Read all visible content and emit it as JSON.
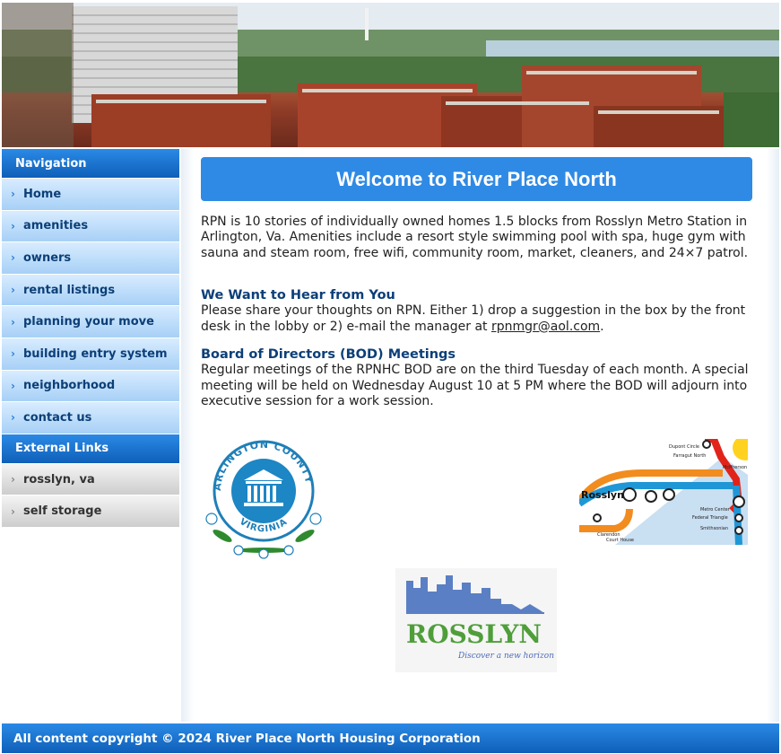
{
  "banner": {
    "alt": "River Place North aerial view"
  },
  "sidebar": {
    "nav_heading": "Navigation",
    "nav_items": [
      {
        "label": "Home"
      },
      {
        "label": "amenities"
      },
      {
        "label": "owners"
      },
      {
        "label": "rental listings"
      },
      {
        "label": "planning your move"
      },
      {
        "label": "building entry system"
      },
      {
        "label": "neighborhood"
      },
      {
        "label": "contact us"
      }
    ],
    "ext_heading": "External Links",
    "ext_items": [
      {
        "label": "rosslyn, va"
      },
      {
        "label": "self storage"
      }
    ]
  },
  "main": {
    "title": "Welcome to River Place North",
    "intro": "RPN is 10 stories of individually owned homes 1.5 blocks from Rosslyn Metro Station in Arlington, Va. Amenities include a resort style swimming pool with spa, huge gym with sauna and steam room, free wifi, community room, market, cleaners, and 24×7 patrol.",
    "feedback_heading": "We Want to Hear from You",
    "feedback_text": "Please share your thoughts on RPN. Either 1) drop a suggestion in the box by the front desk in the lobby or 2) e-mail the manager at ",
    "feedback_email": "rpnmgr@aol.com",
    "feedback_end": ".",
    "bod_heading": "Board of Directors (BOD) Meetings",
    "bod_text": "Regular meetings of the RPNHC BOD are on the third Tuesday of each month. A special meeting will be held on Wednesday August 10 at 5 PM where the BOD will adjourn into executive session for a work session."
  },
  "logos": {
    "arlington_top": "ARLINGTON COUNTY",
    "arlington_bottom": "VIRGINIA",
    "metro_station": "Rosslyn",
    "metro_stations": [
      "Dupont Circle",
      "Farragut North",
      "McPherson",
      "Metro Center",
      "Federal Triangle",
      "Smithsonian",
      "Clarendon",
      "Court House"
    ],
    "rosslyn_name": "ROSSLYN",
    "rosslyn_tagline": "Discover a new horizon"
  },
  "footer": {
    "copyright": "All content copyright © 2024 River Place North Housing Corporation"
  }
}
